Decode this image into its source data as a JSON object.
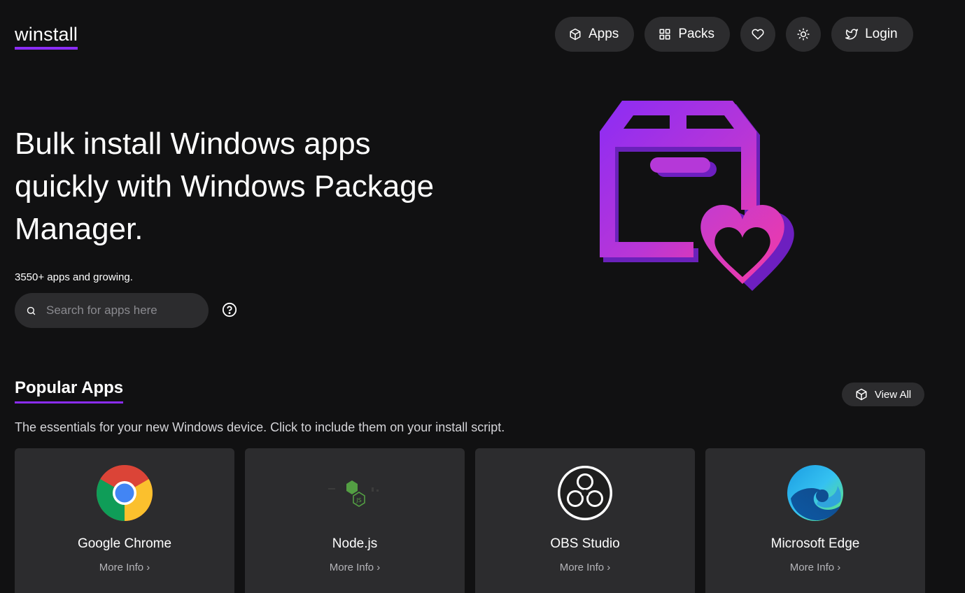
{
  "header": {
    "logo": "winstall",
    "nav": {
      "apps_label": "Apps",
      "packs_label": "Packs",
      "login_label": "Login"
    }
  },
  "hero": {
    "title": "Bulk install Windows apps quickly with Windows Package Manager.",
    "subtitle": "3550+ apps and growing.",
    "search_placeholder": "Search for apps here"
  },
  "popular": {
    "title": "Popular Apps",
    "view_all_label": "View All",
    "description": "The essentials for your new Windows device. Click to include them on your install script.",
    "apps": [
      {
        "name": "Google Chrome",
        "more": "More Info ›",
        "icon": "chrome-icon"
      },
      {
        "name": "Node.js",
        "more": "More Info ›",
        "icon": "nodejs-icon"
      },
      {
        "name": "OBS Studio",
        "more": "More Info ›",
        "icon": "obs-icon"
      },
      {
        "name": "Microsoft Edge",
        "more": "More Info ›",
        "icon": "edge-icon"
      }
    ]
  },
  "colors": {
    "background": "#111112",
    "surface": "#2c2c2e",
    "accent": "#8b2cf5",
    "art_gradient_start": "#8b2cf5",
    "art_gradient_end": "#f03aa8"
  }
}
